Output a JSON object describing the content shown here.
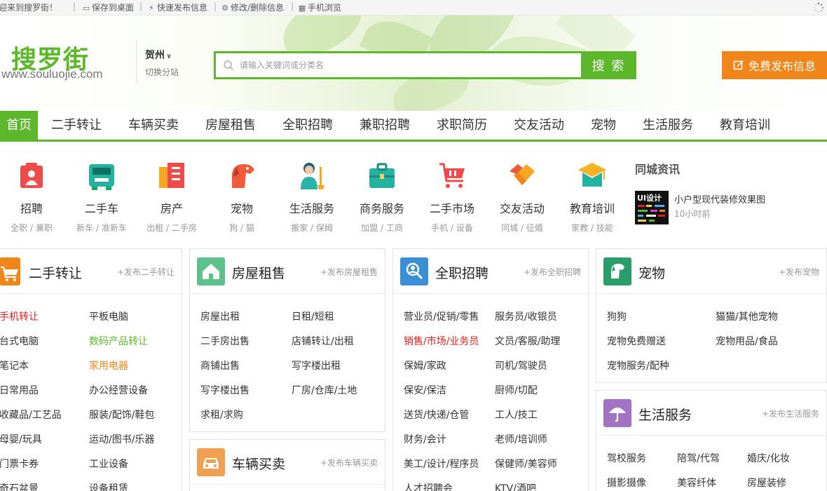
{
  "topbar": {
    "welcome": "欢迎来到搜罗街！",
    "links": [
      "保存到桌面",
      "快速发布信息",
      "修改/删除信息",
      "手机浏览"
    ]
  },
  "logo": {
    "cn": "搜罗街",
    "en": "www.souluojie.com"
  },
  "city": {
    "name": "贺州",
    "switch": "切换分站"
  },
  "search": {
    "placeholder": "请输入关键词或分类名",
    "button": "搜 索"
  },
  "publish": {
    "label": "免费发布信息"
  },
  "nav": [
    "首页",
    "二手转让",
    "车辆买卖",
    "房屋租售",
    "全职招聘",
    "兼职招聘",
    "求职简历",
    "交友活动",
    "宠物",
    "生活服务",
    "教育培训"
  ],
  "categories": [
    {
      "name": "招聘",
      "sub": "全职 / 兼职",
      "icon": "briefcase-icon"
    },
    {
      "name": "二手车",
      "sub": "新车 / 准新车",
      "icon": "jeep-icon"
    },
    {
      "name": "房产",
      "sub": "出租 / 二手房",
      "icon": "building-icon"
    },
    {
      "name": "宠物",
      "sub": "狗 / 猫",
      "icon": "dog-icon"
    },
    {
      "name": "生活服务",
      "sub": "搬家 / 保姆",
      "icon": "cleaner-icon"
    },
    {
      "name": "商务服务",
      "sub": "加盟 / 工商",
      "icon": "toolbox-icon"
    },
    {
      "name": "二手市场",
      "sub": "手机 / 设备",
      "icon": "cart-icon"
    },
    {
      "name": "交友活动",
      "sub": "同城 / 征婚",
      "icon": "handshake-icon"
    },
    {
      "name": "教育培训",
      "sub": "家教 / 技能",
      "icon": "graduation-cap-icon"
    }
  ],
  "news": {
    "title": "同城资讯",
    "item": {
      "title": "小户型现代装修效果图",
      "time": "10小时前",
      "thumb_text": "UI设计"
    }
  },
  "panels": {
    "secondhand": {
      "title": "二手转让",
      "add": "+发布二手转让",
      "links": [
        "手机转让",
        "平板电脑",
        "台式电脑",
        "数码产品转让",
        "笔记本",
        "家用电器",
        "日常用品",
        "办公经营设备",
        "收藏品/工艺品",
        "服装/配饰/鞋包",
        "母婴/玩具",
        "运动/图书/乐器",
        "门票卡券",
        "工业设备",
        "奇石盆景",
        "设备租赁"
      ]
    },
    "house": {
      "title": "房屋租售",
      "add": "+发布房屋租售",
      "links": [
        "房屋出租",
        "日租/短租",
        "二手房出售",
        "店铺转让/出租",
        "商铺出售",
        "写字楼出租",
        "写字楼出售",
        "厂房/仓库/土地",
        "求租/求购"
      ]
    },
    "vehicle": {
      "title": "车辆买卖",
      "add": "+发布车辆买卖"
    },
    "jobs": {
      "title": "全职招聘",
      "add": "+发布全职招聘",
      "links": [
        "营业员/促销/零售",
        "服务员/收银员",
        "销售/市场/业务员",
        "文员/客服/助理",
        "保姆/家政",
        "司机/驾驶员",
        "保安/保洁",
        "厨师/切配",
        "送货/快递/仓管",
        "工人/技工",
        "财务/会计",
        "老师/培训师",
        "美工/设计/程序员",
        "保健师/美容师",
        "人才招聘会",
        "KTV/酒吧"
      ]
    },
    "pets": {
      "title": "宠物",
      "add": "+发布宠物",
      "links": [
        "狗狗",
        "猫猫/其他宠物",
        "宠物免费赠送",
        "宠物用品/食品",
        "宠物服务/配种"
      ]
    },
    "life": {
      "title": "生活服务",
      "add": "+发布生活服务",
      "links": [
        "驾校服务",
        "陪驾/代驾",
        "婚庆/化妆",
        "摄影摄像",
        "美容纤体",
        "房屋装修"
      ]
    }
  },
  "colors": {
    "brand_green": "#5cb82a",
    "orange": "#f08519",
    "red_link": "#e02020"
  }
}
